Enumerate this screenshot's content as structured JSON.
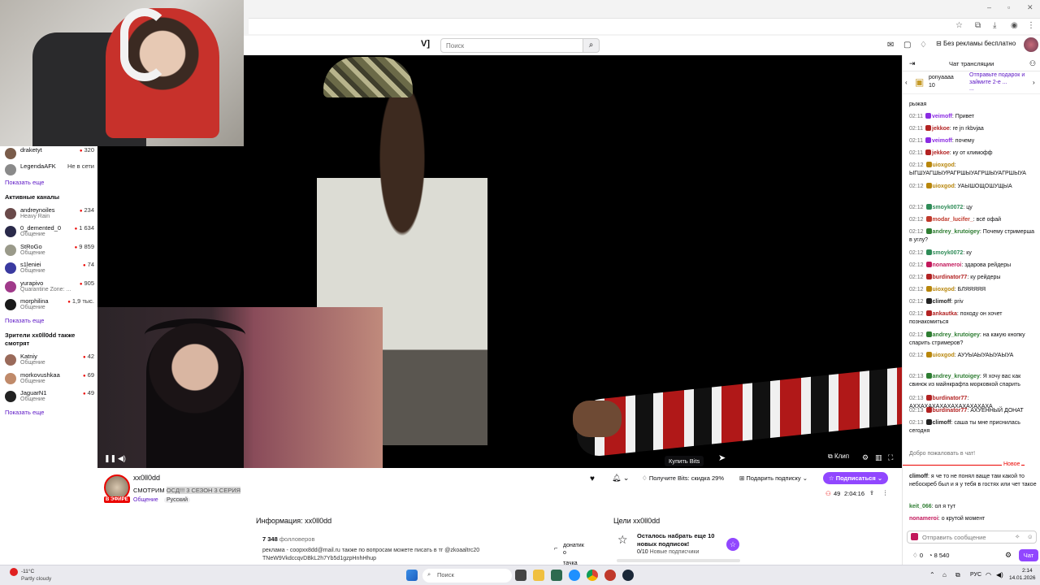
{
  "browser": {
    "search_placeholder": "Поиск",
    "noads_label": "Без рекламы бесплатно"
  },
  "sidebar": {
    "followed": [
      {
        "name": "draketyt",
        "viewers": "320",
        "color": "#7a5c4a"
      },
      {
        "name": "LegendaAFK",
        "status": "Не в сети",
        "color": "#8a8a8a"
      }
    ],
    "show_more_1": "Показать еще",
    "active_header": "Активные каналы",
    "active": [
      {
        "name": "andreynoiles",
        "category": "Heavy Rain",
        "viewers": "234",
        "color": "#6a4a4a"
      },
      {
        "name": "0_demented_0",
        "category": "Общение",
        "viewers": "1 634",
        "color": "#2a2a4a"
      },
      {
        "name": "StRoGo",
        "category": "Общение",
        "viewers": "9 859",
        "color": "#9a9a8a"
      },
      {
        "name": "s1leniei",
        "category": "Общение",
        "viewers": "74",
        "color": "#3a3aa0"
      },
      {
        "name": "yurapivo",
        "category": "Quarantine Zone: ...",
        "viewers": "905",
        "color": "#a03a8a"
      },
      {
        "name": "morphilina",
        "category": "Общение",
        "viewers": "1,9 тыс.",
        "color": "#1a1a1a"
      }
    ],
    "show_more_2": "Показать еще",
    "watchers_header": "Зрители xx0ll0dd также смотрят",
    "watchers": [
      {
        "name": "Katniy",
        "category": "Общение",
        "viewers": "42",
        "color": "#9a6a5a"
      },
      {
        "name": "morkovushkaa",
        "category": "Общение",
        "viewers": "69",
        "color": "#c08a6a"
      },
      {
        "name": "JaguarN1",
        "category": "Общение",
        "viewers": "49",
        "color": "#222222"
      }
    ],
    "show_more_3": "Показать еще"
  },
  "player": {
    "clip_label": "Клип",
    "tooltip": "Купить Bits"
  },
  "stream": {
    "streamer": "xx0ll0dd",
    "title_prefix": "СМОТРИМ",
    "title_highlight": "ОСД!!! 3 СЕЗОН 3 СЕРИЯ",
    "live": "В ЭФИРЕ",
    "category": "Общение",
    "language": "Русский",
    "bits_promo": "Получите Bits: скидка 29%",
    "gift_sub": "Подарить подписку",
    "subscribe": "Подписаться",
    "viewers": "49",
    "uptime": "2:04:16"
  },
  "about": {
    "header": "Информация: xx0ll0dd",
    "followers": "7 348",
    "followers_label": "фолловеров",
    "description_1": "реклама - coopxx8dd@mail.ru также по вопросам можете писать в тг @zkoaaltrc20",
    "description_2": "TNeW9VkdccqvDBkL2h7Yb5d1gzpHnhHhup",
    "panel_1": "донатик",
    "panel_1b": "о",
    "panel_2": "тачка"
  },
  "goals": {
    "header": "Цели xx0ll0dd",
    "text_1": "Осталось набрать еще 10",
    "text_2": "новых подписок!",
    "progress": "0/10",
    "progress_label": "Новые подписчики"
  },
  "chat": {
    "title": "Чат трансляции",
    "gift_user": "ponyaaaa",
    "gift_count": "10",
    "gift_promo": "Отправьте подарок и займите 2-е ...",
    "gift_more": "...",
    "top_partial": "рыжая",
    "messages": [
      {
        "time": "02:11",
        "user": "veimoff",
        "color": "#8a2be2",
        "text": "Привет"
      },
      {
        "time": "02:11",
        "user": "jekkoe",
        "color": "#b22222",
        "text": "re jn rkbvjaa"
      },
      {
        "time": "02:11",
        "user": "veimoff",
        "color": "#8a2be2",
        "text": "почему"
      },
      {
        "time": "02:11",
        "user": "jekkoe",
        "color": "#b22222",
        "text": "ку от климофф"
      },
      {
        "time": "02:12",
        "user": "uioxgod",
        "color": "#b8860b",
        "text": "ЫГШУАГШЫУРАГРШЫУАГРШЫУАГРШЫУА"
      },
      {
        "time": "02:12",
        "user": "uioxgod",
        "color": "#b8860b",
        "text": "УАЫШОЩОШУЩЫА"
      },
      {
        "time": "02:12",
        "user": "smoyk0072",
        "color": "#2e8b57",
        "text": "цу"
      },
      {
        "time": "02:12",
        "user": "modar_lucifer_",
        "color": "#c0392b",
        "text": "всё офай"
      },
      {
        "time": "02:12",
        "user": "andrey_krutoigey",
        "color": "#2e7d32",
        "text": "Почему стримерша в углу?"
      },
      {
        "time": "02:12",
        "user": "smoyk0072",
        "color": "#2e8b57",
        "text": "ку"
      },
      {
        "time": "02:12",
        "user": "nonameroi",
        "color": "#c2185b",
        "text": "здарова рейдеры"
      },
      {
        "time": "02:12",
        "user": "burdinator77",
        "color": "#b22222",
        "text": "ку рейдеры"
      },
      {
        "time": "02:12",
        "user": "uioxgod",
        "color": "#b8860b",
        "text": "БЛЯЯЯЯЯ"
      },
      {
        "time": "02:12",
        "user": "climoff",
        "color": "#222222",
        "text": "priv"
      },
      {
        "time": "02:12",
        "user": "ankautka",
        "color": "#b22222",
        "text": "походу он хочет познакомиться"
      },
      {
        "time": "02:12",
        "user": "andrey_krutoigey",
        "color": "#2e7d32",
        "text": "на какую кнопку спарить стримеров?"
      },
      {
        "time": "02:12",
        "user": "uioxgod",
        "color": "#b8860b",
        "text": "АУУЫАЫУАЫУАЫУА"
      },
      {
        "time": "02:13",
        "user": "andrey_krutoigey",
        "color": "#2e7d32",
        "text": "Я хочу вас как свинок из майнкрафта морковкой спарить"
      },
      {
        "time": "02:13",
        "user": "burdinator77",
        "color": "#b22222",
        "text": "АХХАХАХАХАХАХАХАХАХАХА"
      },
      {
        "time": "02:13",
        "user": "burdinator77",
        "color": "#b22222",
        "text": "АХУЕННЫЙ ДОНАТ"
      },
      {
        "time": "02:13",
        "user": "climoff",
        "color": "#222222",
        "text": "саша ты мне приснилась сегодня"
      }
    ],
    "welcome": "Добро пожаловать в чат!",
    "new_label": "Новое",
    "new_messages": [
      {
        "user": "climoff",
        "color": "#222222",
        "text": "я че то не понял ваще там какой то небоскреб был и я у тебя в гостях или чет такое"
      },
      {
        "user": "keit_066",
        "color": "#2e7d32",
        "text": "ол я тут"
      },
      {
        "user": "nonameroi",
        "color": "#c2185b",
        "text": "о крутой момент"
      }
    ],
    "input_placeholder": "Отправить сообщение",
    "points_1": "0",
    "points_2": "8 540",
    "send_label": "Чат"
  },
  "taskbar": {
    "weather_temp": "-11°C",
    "weather_desc": "Partly cloudy",
    "search": "Поиск",
    "lang": "РУС",
    "time": "2:14",
    "date": "14.01.2026"
  }
}
